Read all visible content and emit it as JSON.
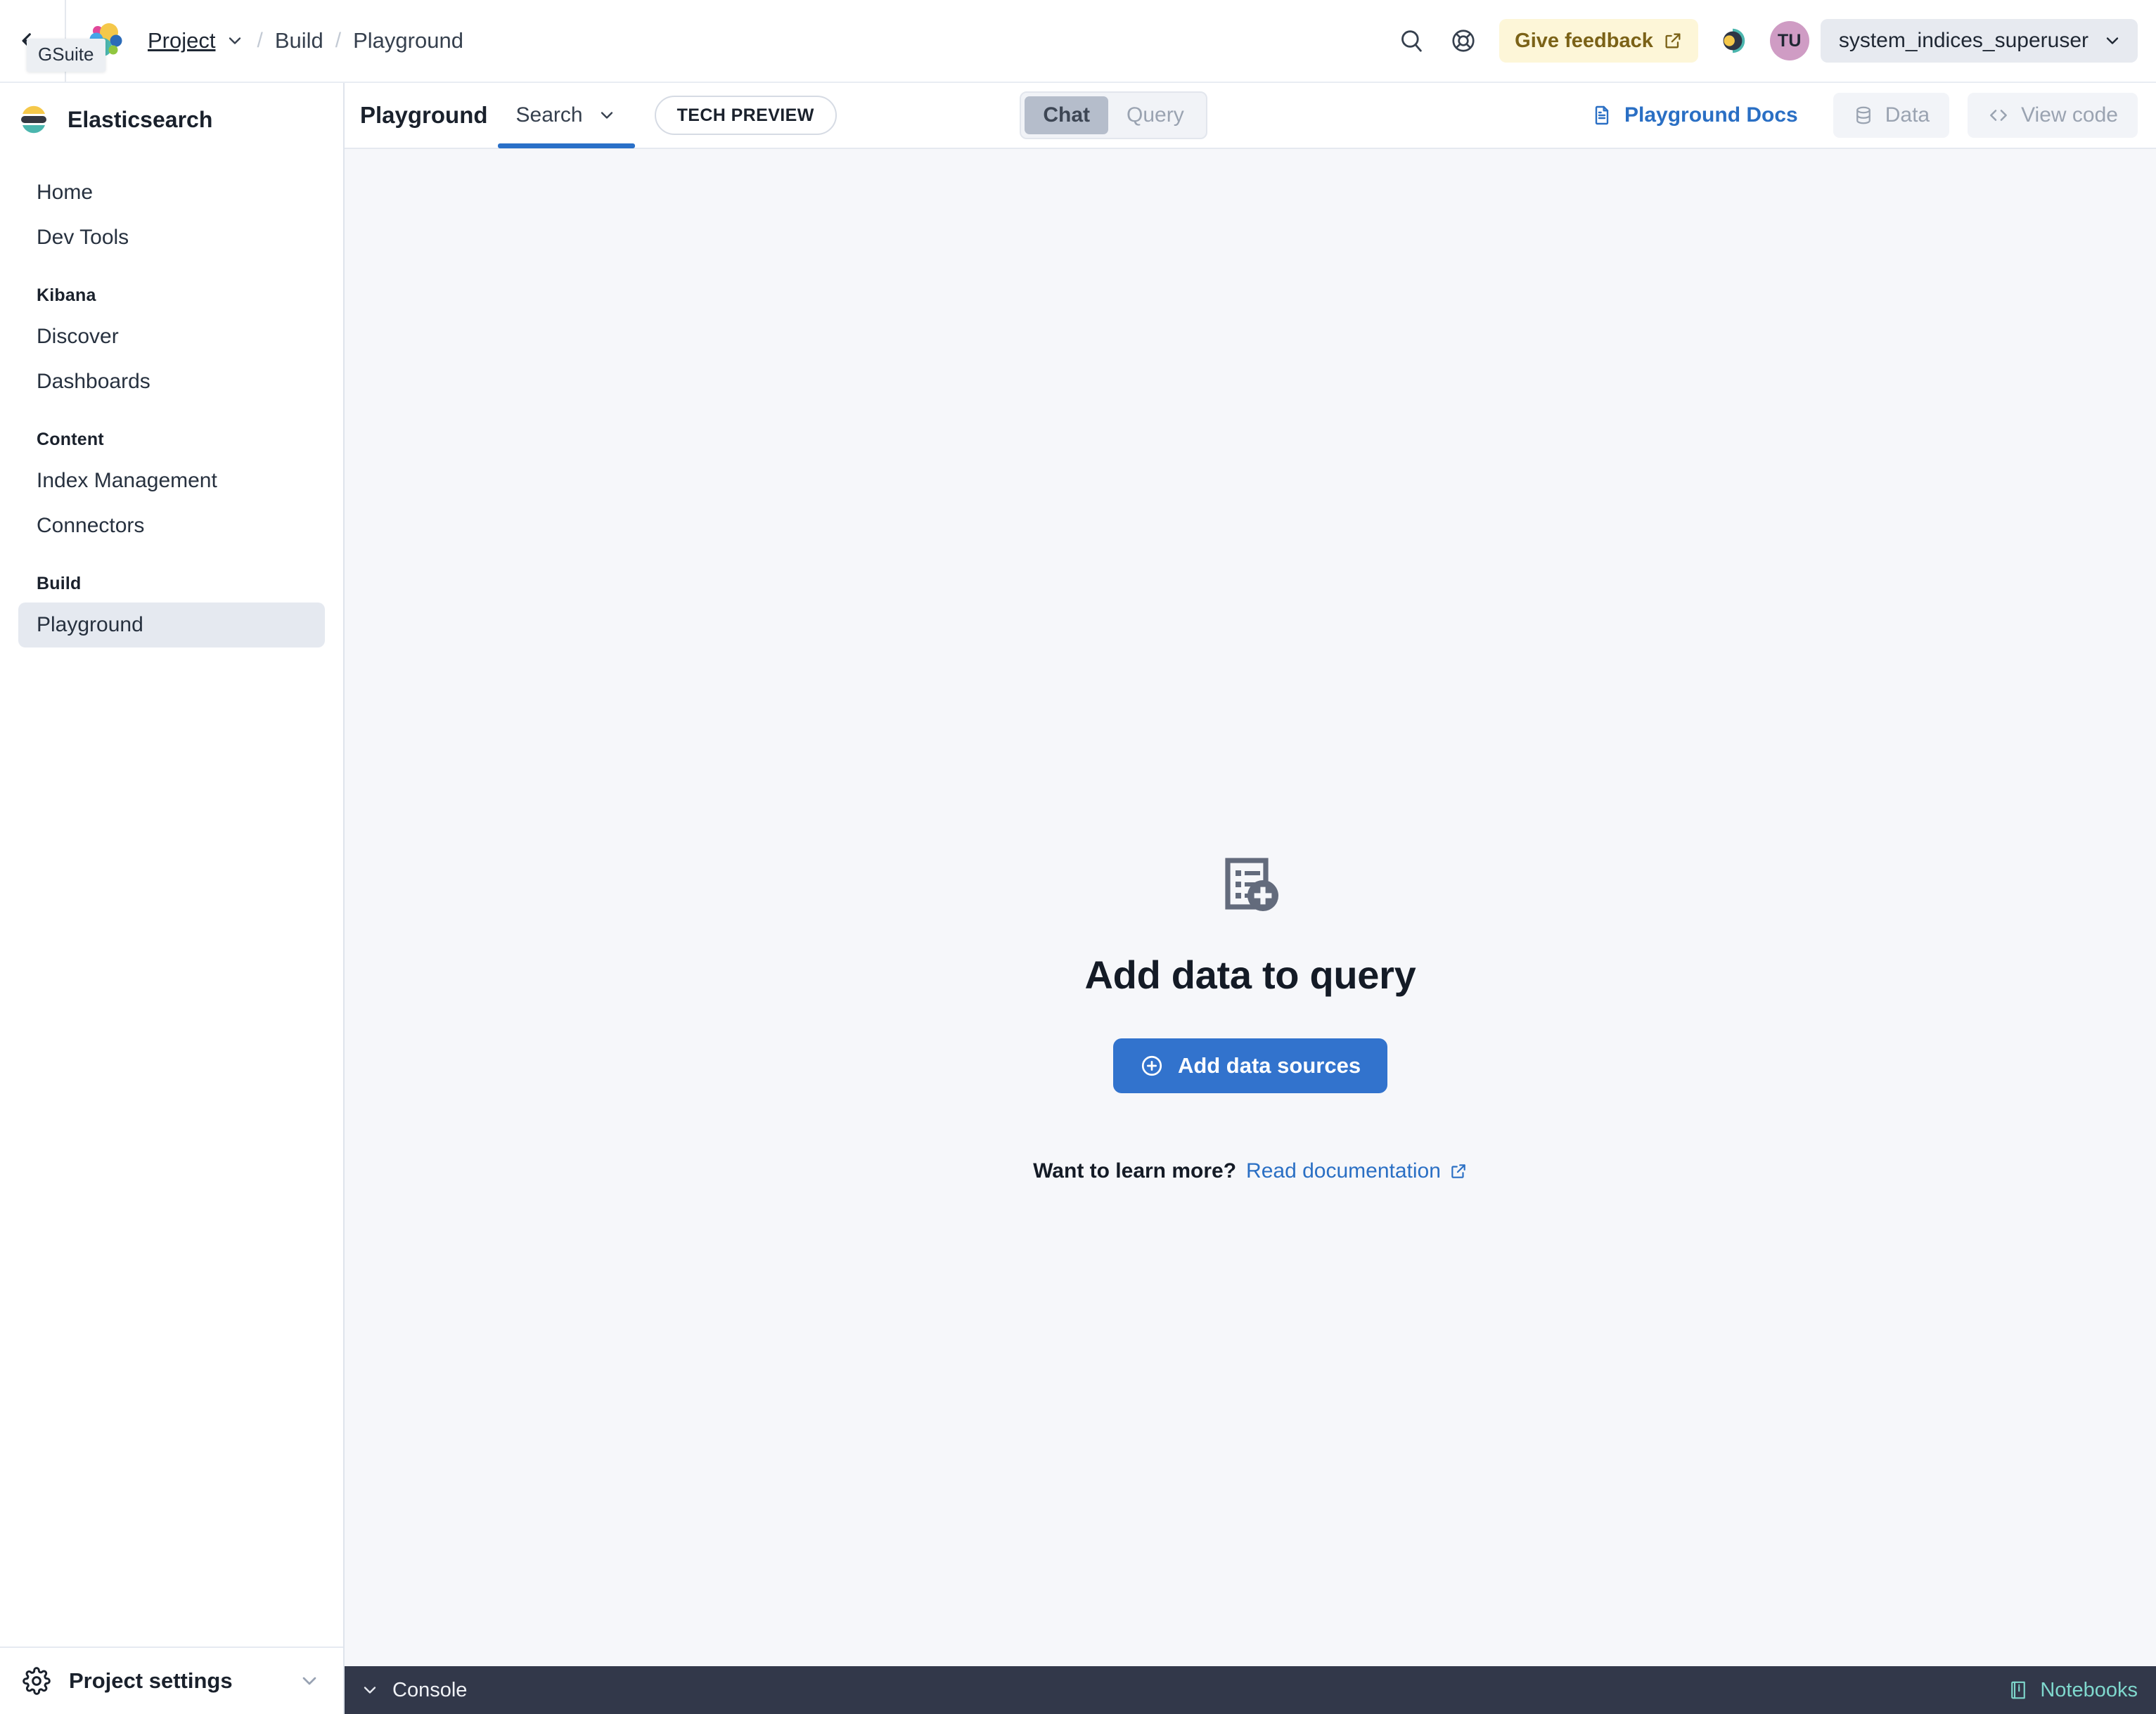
{
  "topbar": {
    "collapse_tooltip": "GSuite",
    "collapse_icon": "collapse-left-icon",
    "logo_icon": "elastic-logo-icon",
    "breadcrumbs": [
      {
        "label": "Project",
        "type": "link-with-caret"
      },
      {
        "label": "Build",
        "type": "text"
      },
      {
        "label": "Playground",
        "type": "text"
      }
    ],
    "separator": "/",
    "search_icon": "search-icon",
    "help_icon": "help-lifebuoy-icon",
    "feedback_label": "Give feedback",
    "feedback_external_icon": "external-link-icon",
    "theme_toggle_icon": "theme-toggle-icon",
    "avatar_initials": "TU",
    "user_name": "system_indices_superuser",
    "user_caret_icon": "chevron-down-icon",
    "feedback_bg": "#fdf6d8",
    "feedback_fg": "#7b6217",
    "avatar_bg": "#cf9cc4"
  },
  "sidebar": {
    "brand": "Elasticsearch",
    "brand_icon": "elasticsearch-logo-icon",
    "items": [
      {
        "label": "Home",
        "active": false
      },
      {
        "label": "Dev Tools",
        "active": false
      }
    ],
    "groups": [
      {
        "title": "Kibana",
        "items": [
          {
            "label": "Discover",
            "active": false
          },
          {
            "label": "Dashboards",
            "active": false
          }
        ]
      },
      {
        "title": "Content",
        "items": [
          {
            "label": "Index Management",
            "active": false
          },
          {
            "label": "Connectors",
            "active": false
          }
        ]
      },
      {
        "title": "Build",
        "items": [
          {
            "label": "Playground",
            "active": true
          }
        ]
      }
    ],
    "footer": {
      "label": "Project settings",
      "icon": "gear-icon",
      "caret_icon": "chevron-down-icon"
    }
  },
  "apptoolbar": {
    "title": "Playground",
    "mode_select_value": "Search",
    "mode_select_caret": "chevron-down-icon",
    "badge": "TECH PREVIEW",
    "segments": [
      {
        "label": "Chat",
        "selected": true
      },
      {
        "label": "Query",
        "selected": false
      }
    ],
    "docs_link": "Playground Docs",
    "docs_icon": "document-icon",
    "data_button": "Data",
    "data_icon": "database-icon",
    "view_code_button": "View code",
    "view_code_icon": "code-icon",
    "accent": "#2a70c8"
  },
  "empty_state": {
    "icon": "document-add-icon",
    "title": "Add data to query",
    "primary_button": "Add data sources",
    "primary_button_icon": "plus-circle-icon",
    "learn_prompt": "Want to learn more?",
    "learn_link": "Read documentation",
    "learn_link_icon": "external-link-icon",
    "primary_color": "#3273cd"
  },
  "console": {
    "toggle_icon": "chevron-down-icon",
    "label": "Console",
    "notebooks_label": "Notebooks",
    "notebooks_icon": "notebook-icon",
    "bg": "#32384a",
    "notebooks_color": "#7fd8cd"
  }
}
